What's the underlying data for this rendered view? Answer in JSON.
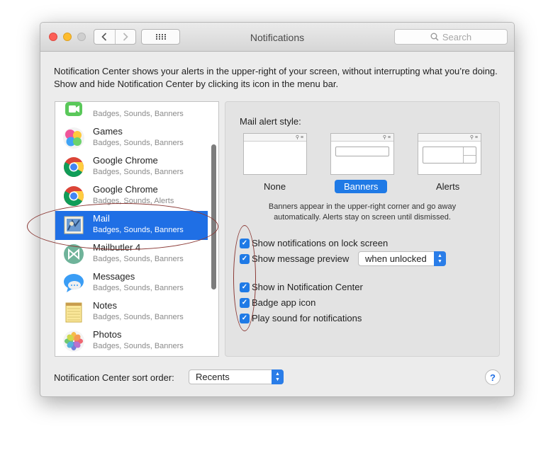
{
  "window": {
    "title": "Notifications",
    "search_placeholder": "Search",
    "description": "Notification Center shows your alerts in the upper-right of your screen, without interrupting what you’re doing. Show and hide Notification Center by clicking its icon in the menu bar."
  },
  "apps": [
    {
      "name": "",
      "sub": "Badges, Sounds, Banners",
      "icon": "facetime-icon"
    },
    {
      "name": "Games",
      "sub": "Badges, Sounds, Banners",
      "icon": "game-center-icon"
    },
    {
      "name": "Google Chrome",
      "sub": "Badges, Sounds, Banners",
      "icon": "chrome-icon"
    },
    {
      "name": "Google Chrome",
      "sub": "Badges, Sounds, Alerts",
      "icon": "chrome-icon"
    },
    {
      "name": "Mail",
      "sub": "Badges, Sounds, Banners",
      "icon": "mail-icon",
      "selected": true
    },
    {
      "name": "Mailbutler 4",
      "sub": "Badges, Sounds, Banners",
      "icon": "mailbutler-icon"
    },
    {
      "name": "Messages",
      "sub": "Badges, Sounds, Banners",
      "icon": "messages-icon"
    },
    {
      "name": "Notes",
      "sub": "Badges, Sounds, Banners",
      "icon": "notes-icon"
    },
    {
      "name": "Photos",
      "sub": "Badges, Sounds, Banners",
      "icon": "photos-icon"
    }
  ],
  "panel": {
    "alert_style_label": "Mail alert style:",
    "styles": [
      "None",
      "Banners",
      "Alerts"
    ],
    "selected_style": "Banners",
    "help_line1": "Banners appear in the upper-right corner and go away",
    "help_line2": "automatically. Alerts stay on screen until dismissed.",
    "options": {
      "lock_screen": "Show notifications on lock screen",
      "preview": "Show message preview",
      "preview_value": "when unlocked",
      "notification_center": "Show in Notification Center",
      "badge": "Badge app icon",
      "sound": "Play sound for notifications"
    }
  },
  "footer": {
    "sort_label": "Notification Center sort order:",
    "sort_value": "Recents",
    "help": "?"
  },
  "colors": {
    "accent": "#1f7ae6",
    "selection": "#1f6fe5",
    "annotation": "#8b3a36"
  }
}
